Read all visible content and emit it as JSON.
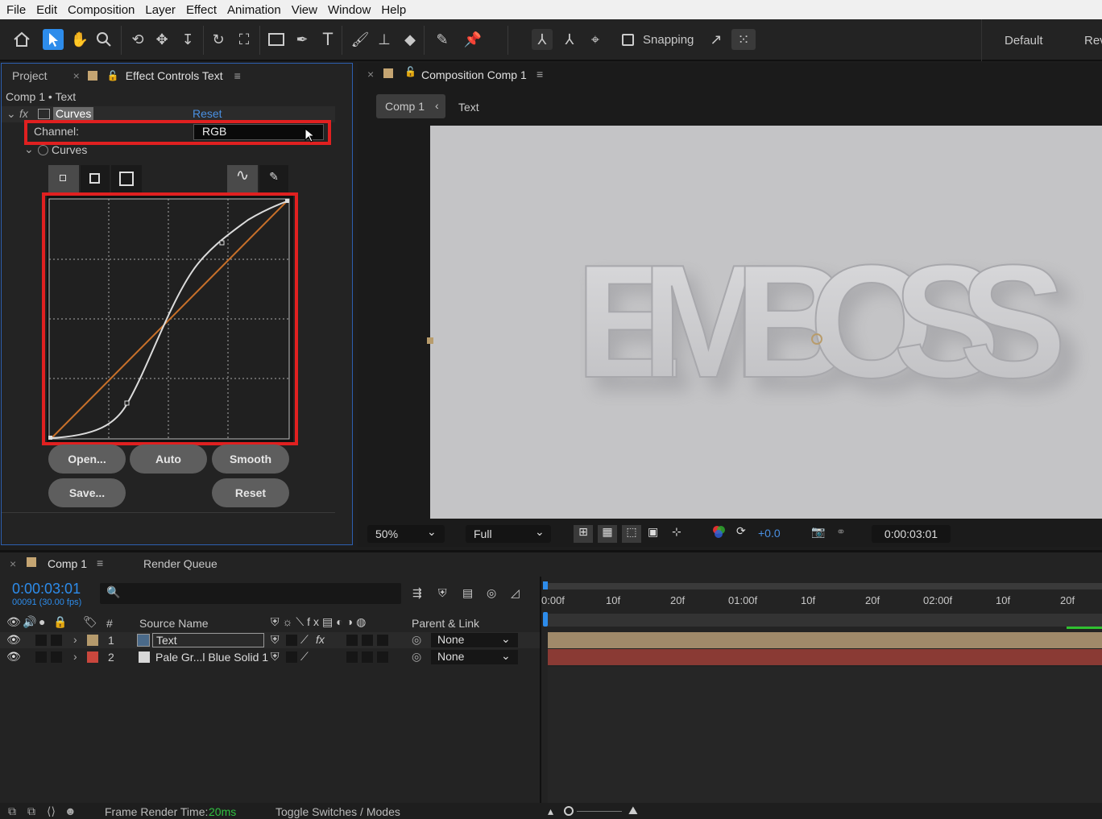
{
  "menu": [
    "File",
    "Edit",
    "Composition",
    "Layer",
    "Effect",
    "Animation",
    "View",
    "Window",
    "Help"
  ],
  "toolbar": {
    "snapping_label": "Snapping",
    "workspace": "Default",
    "workspace_next": "Rev"
  },
  "left_panel": {
    "tab_project": "Project",
    "tab_effect_controls": "Effect Controls Text",
    "breadcrumb": "Comp 1 • Text",
    "fx_label": "fx",
    "effect_name": "Curves",
    "reset_link": "Reset",
    "channel_label": "Channel:",
    "channel_value": "RGB",
    "curves_sub": "Curves",
    "buttons": {
      "open": "Open...",
      "auto": "Auto",
      "smooth": "Smooth",
      "save": "Save...",
      "reset": "Reset"
    }
  },
  "comp_panel": {
    "tab_title": "Composition Comp 1",
    "crumb_comp": "Comp 1",
    "crumb_layer": "Text",
    "canvas_text": "EMBOSS",
    "zoom": "50%",
    "resolution": "Full",
    "exposure": "+0.0",
    "timecode": "0:00:03:01"
  },
  "timeline": {
    "tab_comp": "Comp 1",
    "tab_render_queue": "Render Queue",
    "current_time": "0:00:03:01",
    "frame_info": "00091 (30.00 fps)",
    "columns": {
      "num": "#",
      "source_name": "Source Name",
      "parent": "Parent & Link"
    },
    "ruler": [
      "0:00f",
      "10f",
      "20f",
      "01:00f",
      "10f",
      "20f",
      "02:00f",
      "10f",
      "20f"
    ],
    "layers": [
      {
        "num": "1",
        "name": "Text",
        "parent": "None",
        "label_color": "#b59a6c",
        "bar_color": "#a08a6a"
      },
      {
        "num": "2",
        "name": "Pale Gr...l Blue Solid 1",
        "parent": "None",
        "label_color": "#c9473d",
        "bar_color": "#8a3a34"
      }
    ]
  },
  "status": {
    "render_time_label": "Frame Render Time:",
    "render_time_value": "20ms",
    "toggle_label": "Toggle Switches / Modes"
  },
  "colors": {
    "accent_blue": "#2d8ceb",
    "highlight_red": "#e02020",
    "curve_orange": "#c8702a"
  }
}
